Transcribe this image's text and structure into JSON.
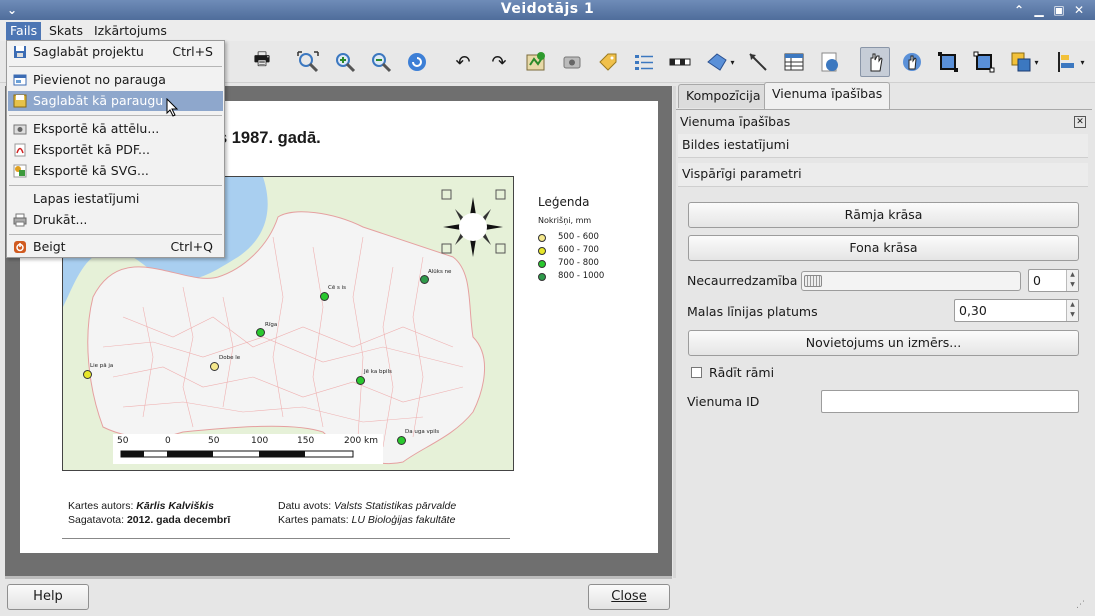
{
  "window": {
    "title": "Veidotājs 1"
  },
  "menubar": {
    "items": [
      "Fails",
      "Skats",
      "Izkārtojums"
    ]
  },
  "file_menu": {
    "items": [
      {
        "label": "Saglabāt projektu",
        "shortcut": "Ctrl+S",
        "icon": "save-icon"
      },
      {
        "label": "Pievienot no parauga",
        "shortcut": "",
        "icon": "template-icon"
      },
      {
        "label": "Saglabāt kā paraugu",
        "shortcut": "",
        "icon": "save-as-template-icon"
      },
      {
        "label": "Eksportē kā attēlu...",
        "shortcut": "",
        "icon": "export-image-icon"
      },
      {
        "label": "Eksportēt kā PDF...",
        "shortcut": "",
        "icon": "pdf-icon"
      },
      {
        "label": "Eksportē kā SVG...",
        "shortcut": "",
        "icon": "svg-icon"
      },
      {
        "label": "Lapas iestatījumi",
        "shortcut": "",
        "icon": ""
      },
      {
        "label": "Drukāt...",
        "shortcut": "",
        "icon": "print-icon"
      },
      {
        "label": "Beigt",
        "shortcut": "Ctrl+Q",
        "icon": "quit-icon"
      }
    ]
  },
  "toolbar": {
    "icons": [
      "print-icon",
      "zoom-full-icon",
      "zoom-in-icon",
      "zoom-out-icon",
      "refresh-icon",
      "undo-icon",
      "redo-icon",
      "add-map-icon",
      "add-image-icon",
      "add-label-icon",
      "add-legend-icon",
      "add-scalebar-icon",
      "add-shape-icon",
      "add-arrow-icon",
      "add-table-icon",
      "add-html-icon",
      "select-move-icon",
      "move-content-icon",
      "group-icon",
      "ungroup-icon",
      "raise-icon",
      "align-icon"
    ]
  },
  "map": {
    "title_fragment": "s 1987. gadā.",
    "legend": {
      "title": "Leģenda",
      "subtitle": "Nokrišņi, mm",
      "entries": [
        {
          "label": "500 - 600",
          "color": "#f5e88c"
        },
        {
          "label": "600 - 700",
          "color": "#e6e62a"
        },
        {
          "label": "700 - 800",
          "color": "#29c82e"
        },
        {
          "label": "800 - 1000",
          "color": "#2e9a4a"
        }
      ]
    },
    "cities": [
      {
        "name": "Lie pā ja",
        "color": "#e6e62a"
      },
      {
        "name": "Dobe le",
        "color": "#f5e88c"
      },
      {
        "name": "Rīga",
        "color": "#29c82e"
      },
      {
        "name": "Cē s is",
        "color": "#29c82e"
      },
      {
        "name": "Alūks ne",
        "color": "#2e9a4a"
      },
      {
        "name": "Jē ka bpils",
        "color": "#29c82e"
      },
      {
        "name": "Da uga vpils",
        "color": "#29c82e"
      }
    ],
    "scalebar": {
      "labels": [
        "50",
        "0",
        "50",
        "100",
        "150",
        "200 km"
      ]
    },
    "footer": {
      "author_label": "Kartes autors:",
      "author": "Kārlis Kalviškis",
      "prepared_label": "Sagatavota:",
      "prepared": "2012. gada decembrī",
      "source_label": "Datu avots:",
      "source": "Valsts Statistikas pārvalde",
      "base_label": "Kartes pamats:",
      "base": "LU Bioloģijas fakultāte"
    }
  },
  "panel": {
    "tabs": [
      "Kompozīcija",
      "Vienuma īpašības"
    ],
    "header": "Vienuma īpašības",
    "sections": [
      "Bildes iestatījumi",
      "Vispārīgi parametri"
    ],
    "frame_color_button": "Rāmja krāsa",
    "bg_color_button": "Fona krāsa",
    "opacity_label": "Necaurredzamība",
    "opacity_value": "0",
    "outline_label": "Malas līnijas platums",
    "outline_value": "0,30",
    "position_button": "Novietojums un izmērs...",
    "show_frame_label": "Rādīt rāmi",
    "item_id_label": "Vienuma ID",
    "item_id_value": ""
  },
  "bottom": {
    "help": "Help",
    "close": "Close"
  }
}
